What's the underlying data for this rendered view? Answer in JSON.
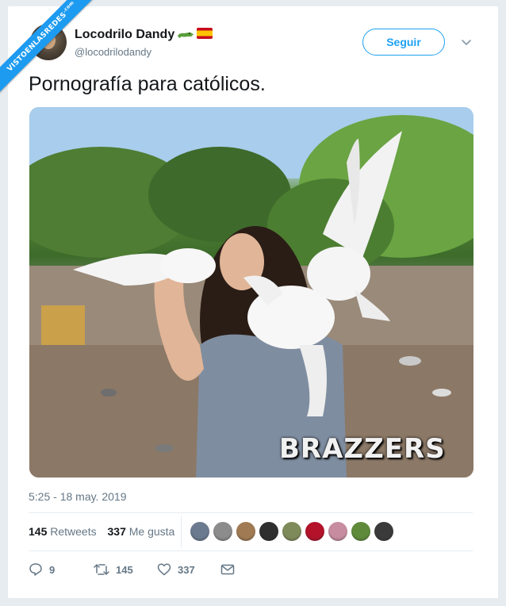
{
  "watermark": {
    "text": "VISTOENLASREDES",
    "domain": ".com"
  },
  "author": {
    "display_name": "Locodrilo Dandy",
    "handle": "@locodrilodandy",
    "name_emojis": [
      "crocodile-emoji",
      "spain-flag-emoji"
    ]
  },
  "follow_button": {
    "label": "Seguir"
  },
  "tweet": {
    "text": "Pornografía para católicos.",
    "image_overlay_text": "BRAZZERS",
    "timestamp": "5:25 - 18 may. 2019"
  },
  "stats": {
    "retweets_count": "145",
    "retweets_label": "Retweets",
    "likes_count": "337",
    "likes_label": "Me gusta",
    "liker_avatars": [
      {
        "name": "liker-avatar-1",
        "color": "#6b7a8f"
      },
      {
        "name": "liker-avatar-2",
        "color": "#8c8c8c"
      },
      {
        "name": "liker-avatar-3",
        "color": "#a07a52"
      },
      {
        "name": "liker-avatar-4",
        "color": "#2f2f2f"
      },
      {
        "name": "liker-avatar-5",
        "color": "#7f8a5a"
      },
      {
        "name": "liker-avatar-6",
        "color": "#b3122a"
      },
      {
        "name": "liker-avatar-7",
        "color": "#c78ca0"
      },
      {
        "name": "liker-avatar-8",
        "color": "#5f8a3a"
      },
      {
        "name": "liker-avatar-9",
        "color": "#3a3a3a"
      }
    ]
  },
  "actions": {
    "replies": "9",
    "retweets": "145",
    "likes": "337"
  },
  "colors": {
    "accent": "#1da1f2",
    "text_primary": "#14171a",
    "text_secondary": "#657786",
    "background": "#e6ecf0"
  }
}
